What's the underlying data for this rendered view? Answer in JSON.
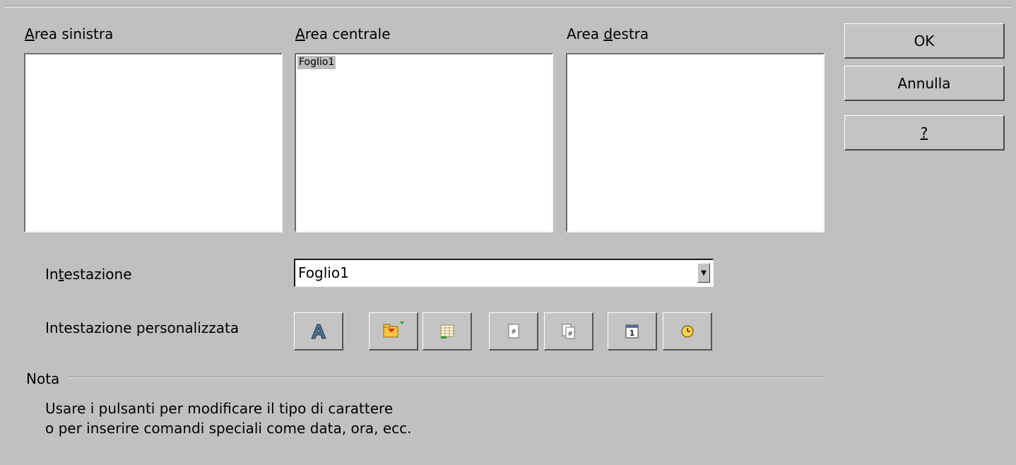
{
  "areas": {
    "left": {
      "label_u": "A",
      "label_rest": "rea sinistra",
      "content": ""
    },
    "center": {
      "label_u": "A",
      "label_rest": "rea centrale",
      "content": "Foglio1"
    },
    "right": {
      "label_pre": "Area ",
      "label_u": "d",
      "label_rest": "estra",
      "content": ""
    }
  },
  "buttons": {
    "ok": "OK",
    "cancel": "Annulla",
    "help": "?"
  },
  "header": {
    "label_pre": "In",
    "label_u": "t",
    "label_rest": "estazione",
    "value": "Foglio1"
  },
  "custom_header": {
    "label": "Intestazione personalizzata",
    "tools": [
      "font-icon",
      "insert-file-icon",
      "sheet-name-icon",
      "page-number-icon",
      "page-count-icon",
      "date-icon",
      "time-icon"
    ]
  },
  "note": {
    "title": "Nota",
    "line1": "Usare i pulsanti per modificare il tipo di carattere",
    "line2": "o per inserire comandi speciali come data, ora, ecc."
  },
  "colors": {
    "dialog_bg": "#c0c0c0",
    "selection_bg": "#bcbcbc",
    "accent_green": "#2e9a2e",
    "accent_orange": "#e88a10"
  }
}
